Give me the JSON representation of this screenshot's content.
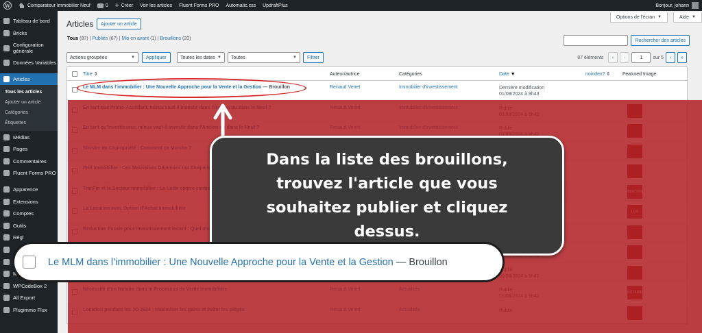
{
  "adminbar": {
    "site_name": "Comparateur Immobilier Neuf",
    "comments_count": "0",
    "new_label": "Créer",
    "items": [
      "Voir les articles",
      "Fluent Forms PRO",
      "Automatic.css",
      "UpdraftPlus"
    ],
    "greeting": "Bonjour, johann"
  },
  "sidebar": {
    "items_top": [
      {
        "label": "Tableau de bord",
        "icon": "dashboard-icon"
      },
      {
        "label": "Bricks",
        "icon": "bricks-icon"
      },
      {
        "label": "Configuration générale",
        "icon": "gear-icon"
      },
      {
        "label": "Données Variables",
        "icon": "database-icon"
      }
    ],
    "active": {
      "label": "Articles",
      "icon": "pin-icon"
    },
    "submenu": [
      "Tous les articles",
      "Ajouter un article",
      "Catégories",
      "Étiquettes"
    ],
    "items_mid": [
      {
        "label": "Médias",
        "icon": "media-icon"
      },
      {
        "label": "Pages",
        "icon": "page-icon"
      },
      {
        "label": "Commentaires",
        "icon": "comment-icon"
      },
      {
        "label": "Fluent Forms PRO",
        "icon": "form-icon"
      }
    ],
    "items_bottom": [
      {
        "label": "Apparence",
        "icon": "brush-icon"
      },
      {
        "label": "Extensions",
        "icon": "plugin-icon"
      },
      {
        "label": "Comptes",
        "icon": "user-icon"
      },
      {
        "label": "Outils",
        "icon": "wrench-icon"
      },
      {
        "label": "Régl",
        "icon": "settings-icon"
      },
      {
        "label": "",
        "icon": "triangle-icon"
      },
      {
        "label": "S",
        "icon": "menu-icon"
      },
      {
        "label": "Meta Box",
        "icon": "metabox-icon"
      },
      {
        "label": "WPCodeBox 2",
        "icon": "code-icon"
      },
      {
        "label": "All Export",
        "icon": "export-icon"
      },
      {
        "label": "Plugimmo Flux",
        "icon": "flux-icon"
      }
    ]
  },
  "header": {
    "screen_options": "Options de l'écran",
    "help": "Aide",
    "title": "Articles",
    "add_new": "Ajouter un article"
  },
  "filters": {
    "all": "Tous",
    "all_count": "(87)",
    "published": "Publiés",
    "published_count": "(67)",
    "sticky": "Mis en avant",
    "sticky_count": "(1)",
    "drafts": "Brouillons",
    "drafts_count": "(20)",
    "search_button": "Rechercher des articles",
    "bulk_actions": "Actions groupées",
    "apply": "Appliquer",
    "all_dates": "Toutes les dates",
    "all_categories": "Toutes",
    "filter": "Filtrer",
    "items_count": "87 éléments",
    "page_first": "«",
    "page_prev": "‹",
    "current_page": "1",
    "of_pages": "sur 5",
    "page_next": "›",
    "page_last": "»"
  },
  "table": {
    "headers": {
      "title": "Titre",
      "author": "Auteur/autrice",
      "categories": "Catégories",
      "date": "Date",
      "noindex": "noindex?",
      "featured": "Featured Image"
    },
    "rows": [
      {
        "title": "Le MLM dans l’immobilier : Une Nouvelle Approche pour la Vente et la Gestion",
        "state": "— Brouillon",
        "author": "Renaud Venet",
        "category": "Immobilier d'investissement",
        "date_status": "Dernière modification",
        "date": "01/08/2024 à 9h43",
        "thumb": ""
      },
      {
        "title": "En tant que Primo-Accédant, mieux vaut-il investir dans l'Ancien ou dans le Neuf ?",
        "state": "",
        "author": "Renaud Venet",
        "category": "Immobilier d'investissement",
        "date_status": "Publié",
        "date": "01/08/2024 à 9h43",
        "thumb": ""
      },
      {
        "title": "En tant qu'Investisseur, mieux vaut-il investir dans l'Ancien ou dans le Neuf ?",
        "state": "",
        "author": "Renaud Venet",
        "category": "Immobilier d'investissement",
        "date_status": "Publié",
        "date": "01/08/2024 à 9h43",
        "thumb": ""
      },
      {
        "title": "Sinistre en Copropriété : Comment ça Marche ?",
        "state": "",
        "author": "Renaud Venet",
        "category": "Immobilier d'investissement",
        "date_status": "Publié",
        "date": "01/08/2024 à 9h43",
        "thumb": ""
      },
      {
        "title": "Prêt Immobilier : Ces Mauvaises Dépenses qui Bloquent",
        "state": "",
        "author": "Renaud Venet",
        "category": "Immobilier d'investissement",
        "date_status": "Publié",
        "date": "01/08/2024 à 9h43",
        "thumb": ""
      },
      {
        "title": "TracFin et le Secteur Immobilier : La Lutte contre contre",
        "state": "",
        "author": "Renaud Venet",
        "category": "Immobilier d'investissement",
        "date_status": "Publié",
        "date": "01/08/2024 à 9h43",
        "thumb": "TRACFIN"
      },
      {
        "title": "La Location avec Option d'Achat Immobilière",
        "state": "",
        "author": "Renaud Venet",
        "category": "Immobilier d'investissement",
        "date_status": "Publié",
        "date": "01/08/2024 à 9h43",
        "thumb": "LOA"
      },
      {
        "title": "Réduction fiscale pour investissement locatif : Quel dispositif",
        "state": "",
        "author": "Renaud Venet",
        "category": "Immobilier d'investissement",
        "date_status": "Publié",
        "date": "01/08/2024 à 9h43",
        "thumb": ""
      },
      {
        "title": "",
        "state": "",
        "author": "",
        "category": "",
        "date_status": "Publié",
        "date": "01/08/2024 à 9h43",
        "thumb": ""
      },
      {
        "title": "Prêt In-Fine et Hypothécaire : Innovations Financières ou Risques Cachés ?",
        "state": "",
        "author": "Renaud Venet",
        "category": "Immobilier d'investissement",
        "date_status": "Publié",
        "date": "01/08/2024 à 9h42",
        "thumb": ""
      },
      {
        "title": "Nécessité d'un Notaire dans le Processus de Vente Immobilière",
        "state": "",
        "author": "Renaud Venet",
        "category": "Actualités",
        "date_status": "Publié",
        "date": "01/08/2024 à 9h42",
        "thumb": "NOTAIRE"
      },
      {
        "title": "Location pendant les JO 2024 : Maximiser les gains et éviter les pièges",
        "state": "",
        "author": "Renaud Venet",
        "category": "Actualités",
        "date_status": "Publié",
        "date": "",
        "thumb": ""
      }
    ]
  },
  "tutorial": {
    "callout": "Dans la liste des brouillons, trouvez l'article que vous souhaitez publier et cliquez dessus.",
    "zoom_title": "Le MLM dans l’immobilier : Une Nouvelle Approche pour la Vente et la Gestion",
    "zoom_dash": "—",
    "zoom_state": "Brouillon"
  },
  "colors": {
    "accent": "#2271b1",
    "overlay": "#b02024",
    "callout_bg": "#3a3a3b",
    "highlight": "#d62828"
  }
}
